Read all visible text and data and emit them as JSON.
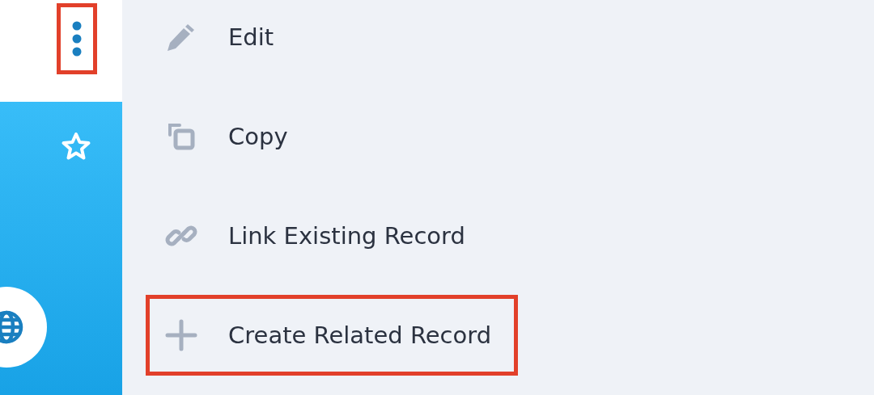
{
  "more_button": {
    "highlighted": true
  },
  "menu": {
    "items": [
      {
        "kind": "edit",
        "label": "Edit",
        "highlighted": false
      },
      {
        "kind": "copy",
        "label": "Copy",
        "highlighted": false
      },
      {
        "kind": "link",
        "label": "Link Existing Record",
        "highlighted": false
      },
      {
        "kind": "create",
        "label": "Create Related Record",
        "highlighted": true
      }
    ]
  }
}
